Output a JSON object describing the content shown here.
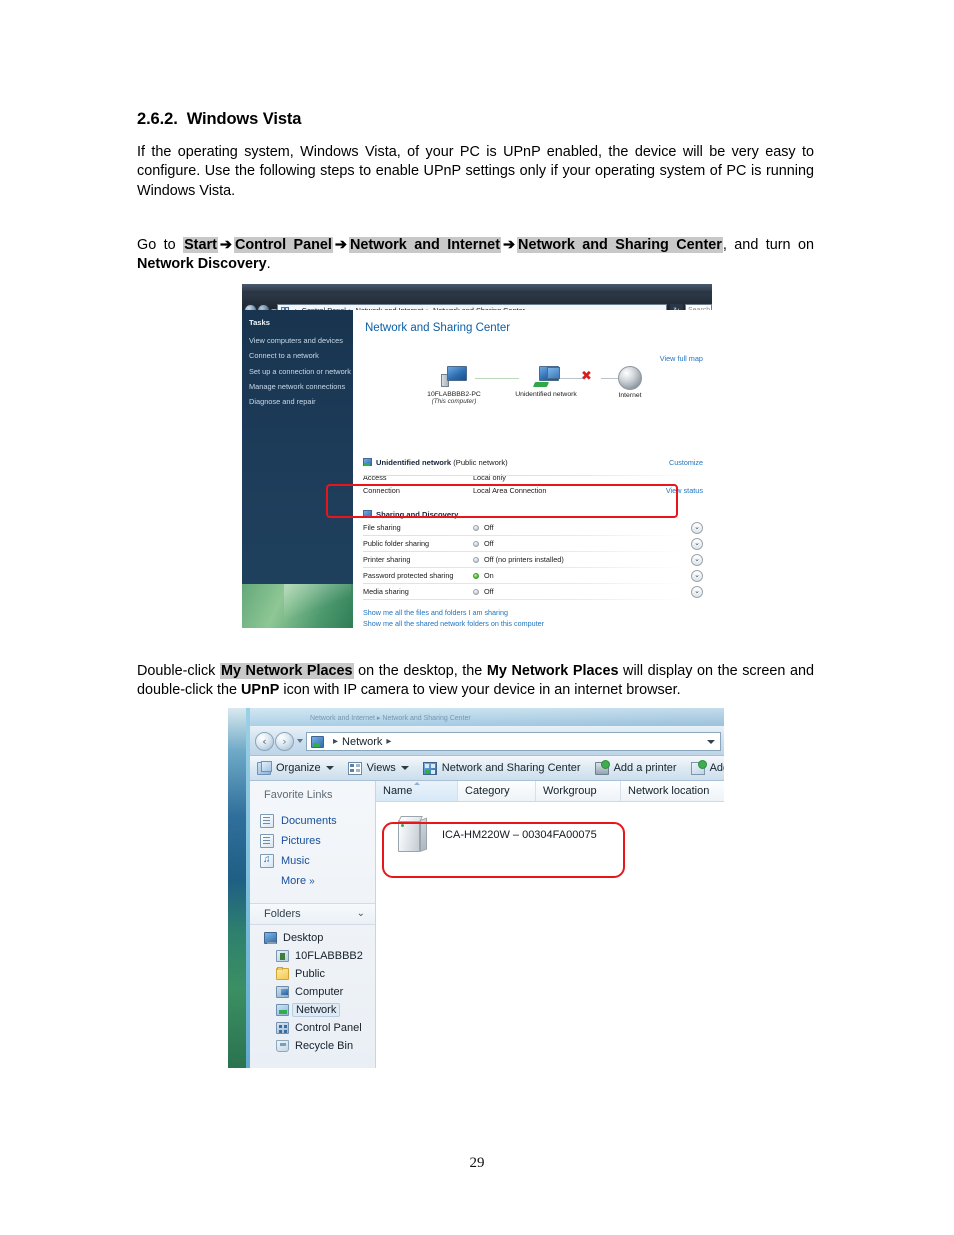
{
  "document": {
    "heading_number": "2.6.2.",
    "heading_title": "Windows Vista",
    "paragraph_intro": "If the operating system, Windows Vista, of your PC is UPnP enabled, the device will be very easy to configure. Use the following steps to enable UPnP settings only if your operating system of PC is running Windows Vista.",
    "goto": {
      "prefix": "Go to ",
      "step1": "Start",
      "arrow": "➔",
      "step2": "Control Panel",
      "step3": "Network and Internet",
      "step4": "Network and Sharing Center",
      "suffix": ", and turn on ",
      "emphasis": "Network Discovery",
      "period": "."
    },
    "doubleclick": {
      "prefix": "Double-click ",
      "highlight": "My Network Places",
      "mid1": " on the desktop, the ",
      "bold1": "My Network Places",
      "mid2": " will display on the screen and double-click the ",
      "bold2": "UPnP",
      "suffix": " icon with IP camera to view your device in an internet browser."
    },
    "page_number": "29"
  },
  "figure1": {
    "address_bar": {
      "breadcrumbs": [
        "Control Panel",
        "Network and Internet",
        "Network and Sharing Center"
      ],
      "separator": "▸",
      "refresh_label": "↻",
      "search_placeholder": "Search"
    },
    "sidebar": {
      "title": "Tasks",
      "items": [
        "View computers and devices",
        "Connect to a network",
        "Set up a connection or network",
        "Manage network connections",
        "Diagnose and repair"
      ]
    },
    "content": {
      "page_title": "Network and Sharing Center",
      "view_full_map": "View full map",
      "map": {
        "node_pc_name": "10FLABBBB2-PC",
        "node_pc_sub": "(This computer)",
        "node_network": "Unidentified network",
        "node_internet": "Internet",
        "broken_link_mark": "✖"
      },
      "network_section": {
        "title": "Unidentified network",
        "subtitle": "(Public network)",
        "customize_link": "Customize",
        "rows": [
          {
            "key": "Access",
            "value": "Local only",
            "action": ""
          },
          {
            "key": "Connection",
            "value": "Local Area Connection",
            "action": "View status"
          }
        ]
      },
      "sharing_section": {
        "title": "Sharing and Discovery",
        "rows": [
          {
            "label": "File sharing",
            "state": "Off",
            "on": false
          },
          {
            "label": "Public folder sharing",
            "state": "Off",
            "on": false
          },
          {
            "label": "Printer sharing",
            "state": "Off (no printers installed)",
            "on": false
          },
          {
            "label": "Password protected sharing",
            "state": "On",
            "on": true
          },
          {
            "label": "Media sharing",
            "state": "Off",
            "on": false
          }
        ],
        "chevron": "⌄"
      },
      "bottom_links": [
        "Show me all the files and folders I am sharing",
        "Show me all the shared network folders on this computer"
      ]
    },
    "highlight_color": "#e8161a"
  },
  "figure2": {
    "background_window_ghost_text": "Network and Internet  ▸  Network and Sharing Center",
    "address_bar": {
      "breadcrumbs": [
        "Network"
      ],
      "separator": "▸",
      "leading_separator": "▸"
    },
    "toolbar": {
      "items": [
        {
          "label": "Organize",
          "icon": "organize-icon",
          "caret": true
        },
        {
          "label": "Views",
          "icon": "views-icon",
          "caret": true
        },
        {
          "label": "Network and Sharing Center",
          "icon": "network-sharing-center-icon",
          "caret": false
        },
        {
          "label": "Add a printer",
          "icon": "printer-icon",
          "caret": false
        },
        {
          "label": "Add",
          "icon": "add-wireless-device-icon",
          "caret": false
        }
      ]
    },
    "sidebar": {
      "favorite_links_title": "Favorite Links",
      "favorites": [
        {
          "label": "Documents",
          "icon": "documents-icon"
        },
        {
          "label": "Pictures",
          "icon": "pictures-icon"
        },
        {
          "label": "Music",
          "icon": "music-icon"
        }
      ],
      "more_label": "More",
      "more_chevron": "»",
      "folders_label": "Folders",
      "folders_chevron": "⌄",
      "tree": [
        {
          "label": "Desktop",
          "icon": "desktop-icon",
          "level": 1,
          "selected": false
        },
        {
          "label": "10FLABBBB2",
          "icon": "user-folder-icon",
          "level": 2,
          "selected": false
        },
        {
          "label": "Public",
          "icon": "folder-icon",
          "level": 2,
          "selected": false
        },
        {
          "label": "Computer",
          "icon": "computer-icon",
          "level": 2,
          "selected": false
        },
        {
          "label": "Network",
          "icon": "network-icon",
          "level": 2,
          "selected": true
        },
        {
          "label": "Control Panel",
          "icon": "control-panel-icon",
          "level": 2,
          "selected": false
        },
        {
          "label": "Recycle Bin",
          "icon": "recycle-bin-icon",
          "level": 2,
          "selected": false
        }
      ]
    },
    "list_view": {
      "columns": [
        {
          "label": "Name",
          "sorted": true
        },
        {
          "label": "Category",
          "sorted": false
        },
        {
          "label": "Workgroup",
          "sorted": false
        },
        {
          "label": "Network location",
          "sorted": false
        }
      ],
      "items": [
        {
          "name": "ICA-HM220W – 00304FA00075",
          "icon": "network-device-icon"
        }
      ]
    },
    "highlight_color": "#e8161a"
  }
}
